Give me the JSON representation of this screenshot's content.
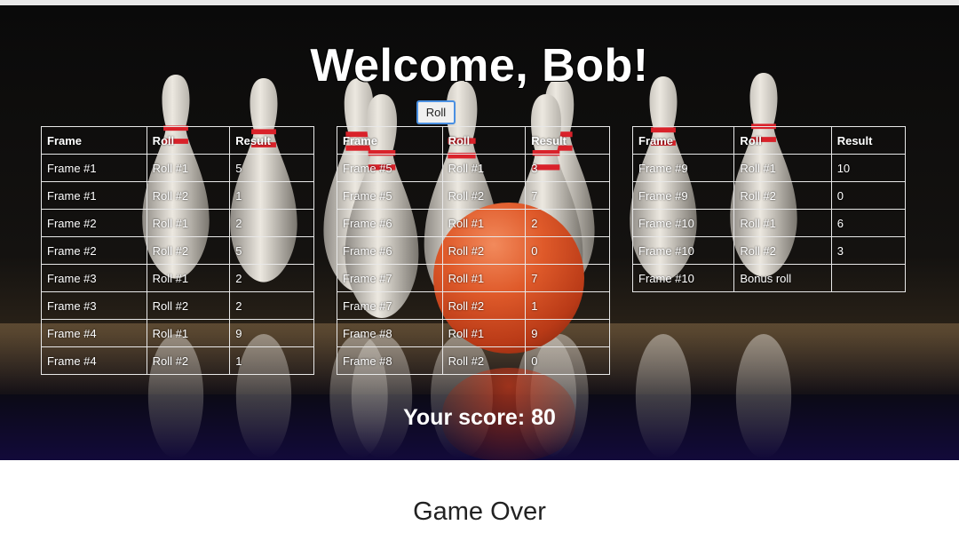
{
  "header": {
    "title": "Welcome, Bob!"
  },
  "controls": {
    "roll_label": "Roll"
  },
  "table_headers": [
    "Frame",
    "Roll",
    "Result"
  ],
  "tables": [
    {
      "rows": [
        [
          "Frame #1",
          "Roll #1",
          "5"
        ],
        [
          "Frame #1",
          "Roll #2",
          "1"
        ],
        [
          "Frame #2",
          "Roll #1",
          "2"
        ],
        [
          "Frame #2",
          "Roll #2",
          "5"
        ],
        [
          "Frame #3",
          "Roll #1",
          "2"
        ],
        [
          "Frame #3",
          "Roll #2",
          "2"
        ],
        [
          "Frame #4",
          "Roll #1",
          "9"
        ],
        [
          "Frame #4",
          "Roll #2",
          "1"
        ]
      ]
    },
    {
      "rows": [
        [
          "Frame #5",
          "Roll #1",
          "3"
        ],
        [
          "Frame #5",
          "Roll #2",
          "7"
        ],
        [
          "Frame #6",
          "Roll #1",
          "2"
        ],
        [
          "Frame #6",
          "Roll #2",
          "0"
        ],
        [
          "Frame #7",
          "Roll #1",
          "7"
        ],
        [
          "Frame #7",
          "Roll #2",
          "1"
        ],
        [
          "Frame #8",
          "Roll #1",
          "9"
        ],
        [
          "Frame #8",
          "Roll #2",
          "0"
        ]
      ]
    },
    {
      "rows": [
        [
          "Frame #9",
          "Roll #1",
          "10"
        ],
        [
          "Frame #9",
          "Roll #2",
          "0"
        ],
        [
          "Frame #10",
          "Roll #1",
          "6"
        ],
        [
          "Frame #10",
          "Roll #2",
          "3"
        ],
        [
          "Frame #10",
          "Bonus roll",
          ""
        ]
      ]
    }
  ],
  "footer": {
    "score_text": "Your score: 80",
    "status_text": "Game Over"
  }
}
